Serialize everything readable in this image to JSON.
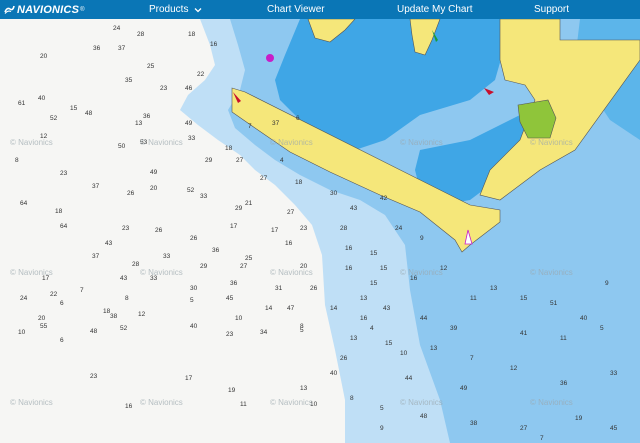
{
  "header": {
    "logo_text": "NAVIONICS",
    "logo_mark": "®",
    "nav": [
      {
        "label": "Products",
        "has_dropdown": true
      },
      {
        "label": "Chart Viewer",
        "has_dropdown": false
      },
      {
        "label": "Update My Chart",
        "has_dropdown": false
      },
      {
        "label": "Support",
        "has_dropdown": false
      }
    ]
  },
  "colors": {
    "header_bg": "#0a76b6",
    "land": "#f5e77a",
    "land_green": "#8fc53a",
    "deep_water": "#f6f6f4",
    "mid_water": "#bfdff6",
    "shallow_water": "#8ec8f0",
    "very_shallow": "#3fa6e6"
  },
  "map": {
    "watermark": "© Navionics",
    "soundings": [
      "24",
      "28",
      "18",
      "16",
      "36",
      "37",
      "20",
      "25",
      "35",
      "22",
      "23",
      "46",
      "40",
      "15",
      "52",
      "36",
      "13",
      "61",
      "48",
      "49",
      "7",
      "37",
      "6",
      "12",
      "53",
      "33",
      "18",
      "8",
      "50",
      "49",
      "29",
      "27",
      "4",
      "23",
      "20",
      "52",
      "27",
      "18",
      "21",
      "64",
      "37",
      "26",
      "33",
      "29",
      "30",
      "43",
      "42",
      "24",
      "23",
      "28",
      "18",
      "23",
      "26",
      "17",
      "17",
      "27",
      "16",
      "15",
      "9",
      "15",
      "64",
      "43",
      "26",
      "36",
      "25",
      "16",
      "13",
      "14",
      "5",
      "16",
      "37",
      "28",
      "33",
      "29",
      "27",
      "20",
      "16",
      "15",
      "12",
      "11",
      "17",
      "43",
      "33",
      "30",
      "36",
      "31",
      "26",
      "16",
      "13",
      "15",
      "9",
      "8",
      "7",
      "6",
      "5",
      "45",
      "47",
      "43",
      "44",
      "39",
      "18",
      "12",
      "10",
      "8",
      "4",
      "41",
      "51",
      "40",
      "24",
      "22",
      "20",
      "14",
      "13",
      "10",
      "7",
      "5",
      "48",
      "52",
      "38",
      "34",
      "23",
      "26",
      "15",
      "13",
      "12",
      "11",
      "10",
      "6",
      "55",
      "40",
      "40",
      "44",
      "49",
      "36",
      "33",
      "23",
      "17",
      "19",
      "13",
      "8",
      "5",
      "48",
      "38",
      "27",
      "19",
      "16",
      "11",
      "10",
      "9",
      "7",
      "45",
      "33",
      "25",
      "15",
      "12",
      "7",
      "4"
    ]
  }
}
